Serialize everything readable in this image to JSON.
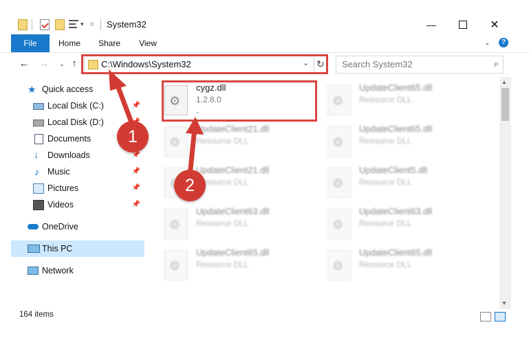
{
  "window": {
    "title": "System32"
  },
  "ribbon": {
    "tabs": [
      "File",
      "Home",
      "Share",
      "View"
    ]
  },
  "address": {
    "path": "C:\\Windows\\System32"
  },
  "search": {
    "placeholder": "Search System32"
  },
  "sidebar": {
    "quick_access": "Quick access",
    "items": [
      {
        "label": "Local Disk (C:)",
        "icon": "drive-icon",
        "pinned": true
      },
      {
        "label": "Local Disk (D:)",
        "icon": "drive-icon",
        "pinned": true
      },
      {
        "label": "Documents",
        "icon": "documents-icon",
        "pinned": true
      },
      {
        "label": "Downloads",
        "icon": "downloads-icon",
        "pinned": true
      },
      {
        "label": "Music",
        "icon": "music-icon",
        "pinned": true
      },
      {
        "label": "Pictures",
        "icon": "pictures-icon",
        "pinned": true
      },
      {
        "label": "Videos",
        "icon": "videos-icon",
        "pinned": true
      }
    ],
    "onedrive": "OneDrive",
    "thispc": "This PC",
    "network": "Network"
  },
  "files": {
    "selected": {
      "name": "cygz.dll",
      "version": "1.2.8.0",
      "extra": "-"
    },
    "blurred": [
      {
        "name": "UpdateClient65.dll",
        "type": "Resource DLL"
      },
      {
        "name": "UpdateClient21.dll",
        "type": "Resource DLL"
      },
      {
        "name": "UpdateClient65.dll",
        "type": "Resource DLL"
      },
      {
        "name": "UpdateClient21.dll",
        "type": "Resource DLL"
      },
      {
        "name": "UpdateClient5.dll",
        "type": "Resource DLL"
      },
      {
        "name": "UpdateClient63.dll",
        "type": "Resource DLL"
      },
      {
        "name": "UpdateClient63.dll",
        "type": "Resource DLL"
      },
      {
        "name": "UpdateClient65.dll",
        "type": "Resource DLL"
      },
      {
        "name": "UpdateClient65.dll",
        "type": "Resource DLL"
      }
    ]
  },
  "status": {
    "count": "164 items"
  },
  "callouts": {
    "one": "1",
    "two": "2"
  },
  "colors": {
    "accent": "#1979ca",
    "highlight": "#d9453f",
    "selection": "#cce8ff"
  }
}
